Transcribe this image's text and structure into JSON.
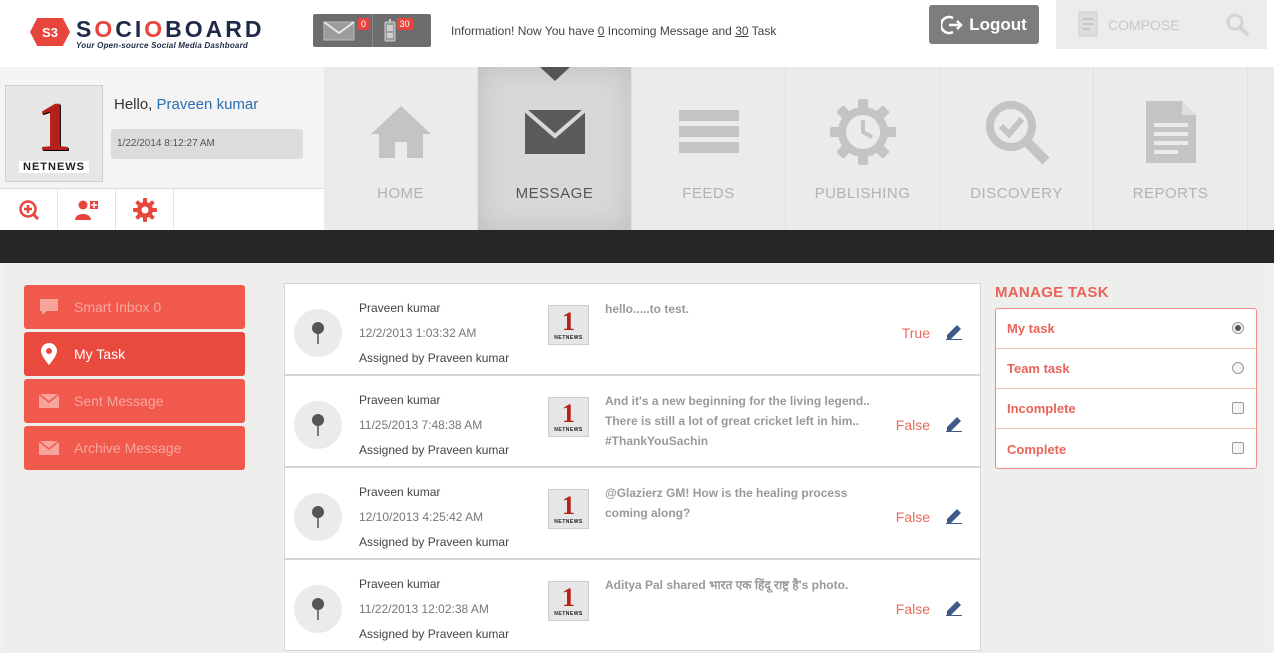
{
  "brand": {
    "badge": "S3",
    "name_pre": "S",
    "name_o1": "O",
    "name_mid": "CI",
    "name_o2": "O",
    "name_post": "BOARD",
    "tagline": "Your Open-source Social Media Dashboard"
  },
  "header": {
    "messages_count": "0",
    "tasks_count": "30",
    "info_prefix": "Information! Now You have ",
    "info_incoming": "0",
    "info_middle": " Incoming Message and ",
    "info_tasks": "30",
    "info_suffix": " Task",
    "logout_label": "Logout",
    "compose_label": "COMPOSE"
  },
  "profile": {
    "greeting": "Hello, ",
    "user_name": "Praveen kumar",
    "datetime": "1/22/2014 8:12:27 AM",
    "avatar_number": "1",
    "avatar_caption": "NETNEWS"
  },
  "nav": [
    {
      "label": "HOME",
      "icon": "home-icon",
      "active": false
    },
    {
      "label": "MESSAGE",
      "icon": "envelope-icon",
      "active": true
    },
    {
      "label": "FEEDS",
      "icon": "feeds-icon",
      "active": false
    },
    {
      "label": "PUBLISHING",
      "icon": "gear-clock-icon",
      "active": false
    },
    {
      "label": "DISCOVERY",
      "icon": "magnifier-check-icon",
      "active": false
    },
    {
      "label": "REPORTS",
      "icon": "document-icon",
      "active": false
    }
  ],
  "sidebar": [
    {
      "label": "Smart Inbox 0",
      "icon": "chat-icon",
      "active": false
    },
    {
      "label": "My Task",
      "icon": "map-pin-icon",
      "active": true
    },
    {
      "label": "Sent Message",
      "icon": "envelope-icon",
      "active": false
    },
    {
      "label": "Archive Message",
      "icon": "envelope-icon",
      "active": false
    }
  ],
  "tasks": [
    {
      "name": "Praveen kumar",
      "date": "12/2/2013 1:03:32 AM",
      "assigned": "Assigned by Praveen kumar",
      "message": "hello.....to test.",
      "status": "True"
    },
    {
      "name": "Praveen kumar",
      "date": "11/25/2013 7:48:38 AM",
      "assigned": "Assigned by Praveen kumar",
      "message": "And it's a new beginning for the living legend.. There is still a lot of great cricket left in him.. #ThankYouSachin",
      "status": "False"
    },
    {
      "name": "Praveen kumar",
      "date": "12/10/2013 4:25:42 AM",
      "assigned": "Assigned by Praveen kumar",
      "message": "@Glazierz GM! How is the healing process coming along?",
      "status": "False"
    },
    {
      "name": "Praveen kumar",
      "date": "11/22/2013 12:02:38 AM",
      "assigned": "Assigned by Praveen kumar",
      "message": "Aditya Pal shared भारत एक हिंदू राष्ट्र है's photo.",
      "status": "False"
    }
  ],
  "manage_task": {
    "title": "MANAGE TASK",
    "options": [
      {
        "label": "My task",
        "control": "radio",
        "checked": true
      },
      {
        "label": "Team task",
        "control": "radio",
        "checked": false
      },
      {
        "label": "Incomplete",
        "control": "checkbox",
        "checked": false
      },
      {
        "label": "Complete",
        "control": "checkbox",
        "checked": false
      }
    ]
  },
  "colors": {
    "accent": "#f1594d",
    "accent_active": "#ea4a3e",
    "brand_navy": "#1e2a48",
    "link_blue": "#2a6fb0"
  }
}
